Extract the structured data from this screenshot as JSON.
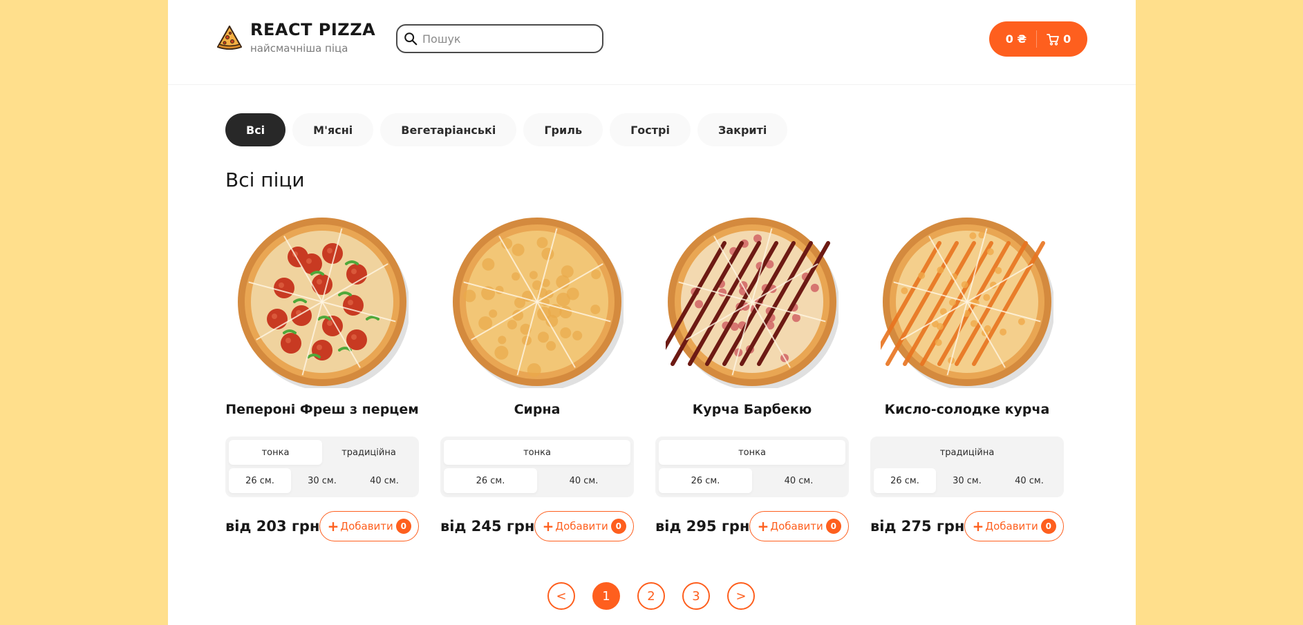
{
  "header": {
    "logo_title": "REACT PIZZA",
    "logo_subtitle": "найсмачніша піца",
    "search_placeholder": "Пошук",
    "search_value": "",
    "cart_price": "0 ₴",
    "cart_count": "0"
  },
  "categories": [
    "Всі",
    "М'ясні",
    "Вегетаріанські",
    "Гриль",
    "Гострі",
    "Закриті"
  ],
  "active_category": "Всі",
  "section_title": "Всі піци",
  "pizzas": [
    {
      "name": "Пепероні Фреш з перцем",
      "types": [
        "тонка",
        "традиційна"
      ],
      "active_type": "тонка",
      "sizes": [
        "26 см.",
        "30 см.",
        "40 см."
      ],
      "active_size": "26 см.",
      "price": "від 203 грн",
      "add_label": "Добавити",
      "count": "0",
      "style": "pepperoni"
    },
    {
      "name": "Сирна",
      "types": [
        "тонка"
      ],
      "active_type": "тонка",
      "sizes": [
        "26 см.",
        "40 см."
      ],
      "active_size": "26 см.",
      "price": "від 245 грн",
      "add_label": "Добавити",
      "count": "0",
      "style": "cheese"
    },
    {
      "name": "Курча Барбекю",
      "types": [
        "тонка"
      ],
      "active_type": "тонка",
      "sizes": [
        "26 см.",
        "40 см."
      ],
      "active_size": "26 см.",
      "price": "від 295 грн",
      "add_label": "Добавити",
      "count": "0",
      "style": "bbq"
    },
    {
      "name": "Кисло-солодке курча",
      "types": [
        "традиційна"
      ],
      "active_type": "",
      "sizes": [
        "26 см.",
        "30 см.",
        "40 см."
      ],
      "active_size": "26 см.",
      "price": "від 275 грн",
      "add_label": "Добавити",
      "count": "0",
      "style": "sweetsour"
    }
  ],
  "pagination": {
    "prev": "<",
    "pages": [
      "1",
      "2",
      "3"
    ],
    "active_page": "1",
    "next": ">"
  },
  "colors": {
    "accent": "#fe5f1e",
    "page_bg": "#ffdf8c",
    "dark": "#282828"
  }
}
